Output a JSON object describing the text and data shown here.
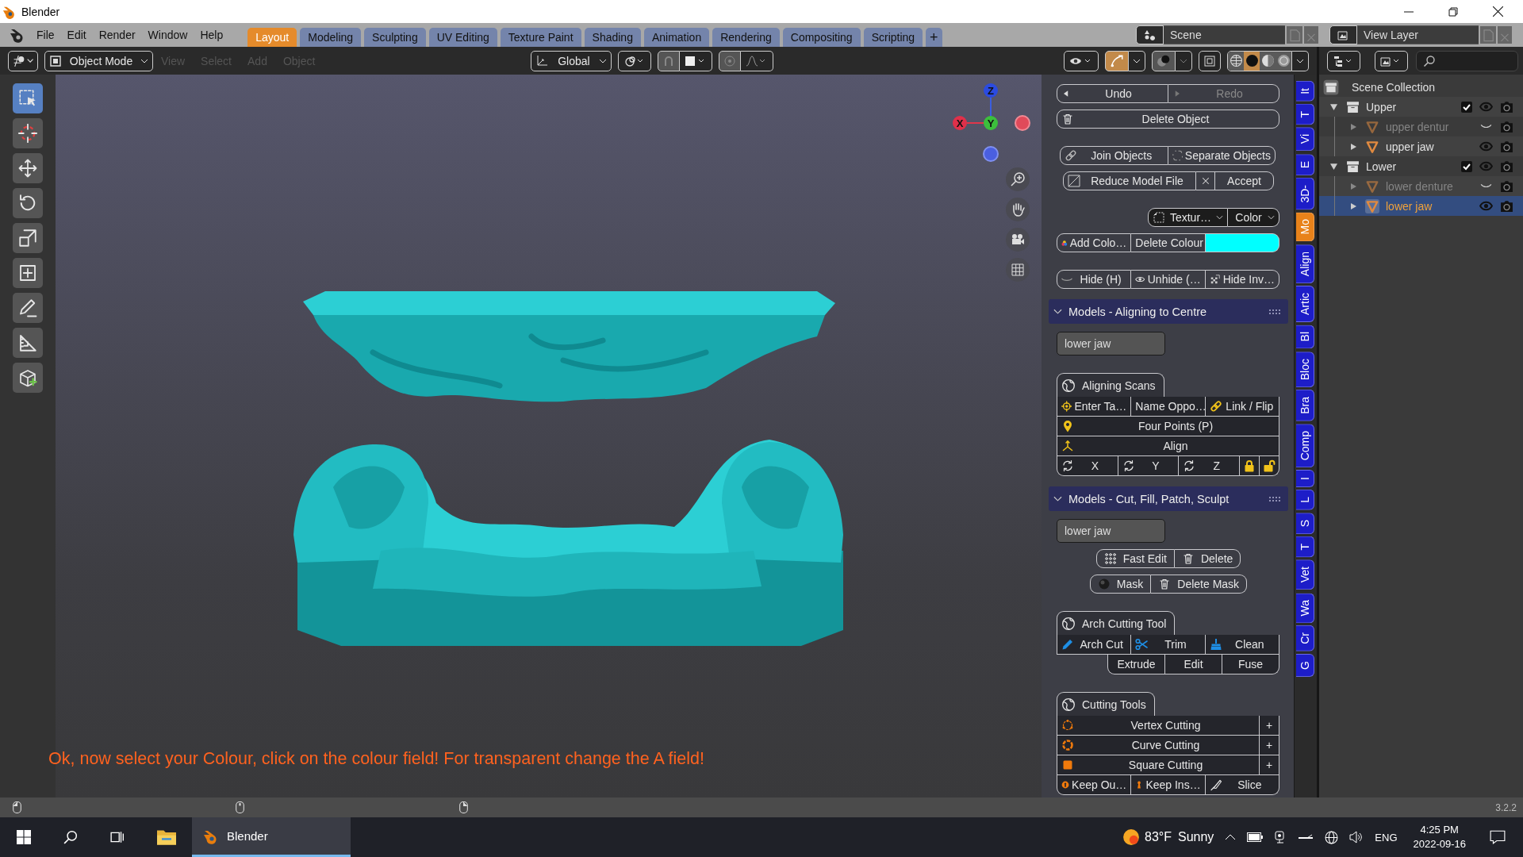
{
  "window": {
    "title": "Blender"
  },
  "topbar": {
    "menus": [
      "File",
      "Edit",
      "Render",
      "Window",
      "Help"
    ],
    "workspaces": [
      {
        "label": "Layout",
        "selected": true
      },
      {
        "label": "Modeling",
        "selected": false
      },
      {
        "label": "Sculpting",
        "selected": false
      },
      {
        "label": "UV Editing",
        "selected": false
      },
      {
        "label": "Texture Paint",
        "selected": false
      },
      {
        "label": "Shading",
        "selected": false
      },
      {
        "label": "Animation",
        "selected": false
      },
      {
        "label": "Rendering",
        "selected": false
      },
      {
        "label": "Compositing",
        "selected": false
      },
      {
        "label": "Scripting",
        "selected": false
      }
    ],
    "add_tab": "+",
    "scene": "Scene",
    "view_layer": "View Layer"
  },
  "header": {
    "mode": "Object Mode",
    "menus": [
      {
        "label": "View",
        "disabled": true
      },
      {
        "label": "Select",
        "disabled": true
      },
      {
        "label": "Add",
        "disabled": true
      },
      {
        "label": "Object",
        "disabled": true
      }
    ],
    "orientation": "Global",
    "gizmos_on": true,
    "shading": [
      {
        "kind": "wireframe",
        "selected": false
      },
      {
        "kind": "solid",
        "selected": true
      },
      {
        "kind": "material",
        "selected": false
      },
      {
        "kind": "rendered",
        "selected": false
      }
    ]
  },
  "tools": [
    {
      "kind": "select",
      "selected": true
    },
    {
      "kind": "cursor",
      "selected": false
    },
    {
      "kind": "move",
      "selected": false
    },
    {
      "kind": "t_rotate",
      "selected": false
    },
    {
      "kind": "scale",
      "selected": false
    },
    {
      "kind": "transform",
      "selected": false
    },
    {
      "kind": "annotate",
      "selected": false
    },
    {
      "kind": "measure",
      "selected": false
    },
    {
      "kind": "add_cube",
      "selected": false
    }
  ],
  "gizmo": {
    "z": "Z",
    "x": "X",
    "y": "Y"
  },
  "message": "Ok, now select your Colour, click on the colour field! For transparent change the A field!",
  "panel": {
    "undo": {
      "label": "Undo",
      "disabled": false
    },
    "redo": {
      "label": "Redo",
      "disabled": true
    },
    "delete_object": "Delete Object",
    "join": "Join Objects",
    "separate": "Separate Objects",
    "reduce": "Reduce Model File",
    "accept": "Accept",
    "texture": "Textur…",
    "color_mode": "Color",
    "add_colour": "Add Colo…",
    "delete_colour": "Delete Colour",
    "colour_field": {
      "color": "#00ffff"
    },
    "hide": "Hide (H)",
    "unhide": "Unhide (…",
    "hide_invert": "Hide Inv…"
  },
  "sections": [
    {
      "title": "Models - Aligning to Centre",
      "expanded": true,
      "object": "lower jaw",
      "groups": [
        {
          "title": "Aligning Scans",
          "rows": [
            {
              "kind": "full",
              "buttons": [
                {
                  "label": "Enter Ta…",
                  "kind": "target"
                },
                {
                  "label": "Name Oppo…",
                  "kind": "none"
                },
                {
                  "label": "Link / Flip",
                  "kind": "link"
                }
              ]
            },
            {
              "kind": "full",
              "buttons": [
                {
                  "label": "Four Points (P)",
                  "kind": "pin"
                }
              ]
            },
            {
              "kind": "full",
              "buttons": [
                {
                  "label": "Align",
                  "kind": "axes"
                }
              ]
            },
            {
              "kind": "full",
              "buttons": [
                {
                  "label": "X",
                  "kind": "rotate"
                },
                {
                  "label": "Y",
                  "kind": "rotate"
                },
                {
                  "label": "Z",
                  "kind": "rotate"
                },
                {
                  "kind": "lock",
                  "locked": true
                },
                {
                  "kind": "lock",
                  "locked": false
                }
              ]
            }
          ]
        }
      ]
    },
    {
      "title": "Models - Cut, Fill, Patch, Sculpt",
      "expanded": true,
      "object": "lower jaw",
      "buttons": [
        {
          "kind": "center",
          "buttons": [
            {
              "label": "Fast Edit",
              "kind": "dots"
            },
            {
              "label": "Delete",
              "kind": "trash"
            }
          ]
        },
        {
          "kind": "center",
          "buttons": [
            {
              "label": "Mask",
              "kind": "sphere"
            },
            {
              "label": "Delete Mask",
              "kind": "trash"
            }
          ]
        }
      ],
      "groups": [
        {
          "title": "Arch Cutting Tool",
          "rows": [
            {
              "kind": "full",
              "buttons": [
                {
                  "label": "Arch Cut",
                  "kind": "pencil"
                },
                {
                  "label": "Trim",
                  "kind": "scissors"
                },
                {
                  "label": "Clean",
                  "kind": "brush"
                }
              ]
            },
            {
              "kind": "inset",
              "buttons": [
                {
                  "label": "Extrude",
                  "kind": "none"
                },
                {
                  "label": "Edit",
                  "kind": "none"
                },
                {
                  "label": "Fuse",
                  "kind": "none"
                }
              ]
            }
          ]
        },
        {
          "title": "Cutting Tools",
          "rows": [
            {
              "kind": "full",
              "buttons": [
                {
                  "label": "Vertex Cutting",
                  "kind": "vertex"
                },
                {
                  "label": "+",
                  "kind": "plus"
                }
              ]
            },
            {
              "kind": "full",
              "buttons": [
                {
                  "label": "Curve Cutting",
                  "kind": "curve"
                },
                {
                  "label": "+",
                  "kind": "plus"
                }
              ]
            },
            {
              "kind": "full",
              "buttons": [
                {
                  "label": "Square Cutting",
                  "kind": "square"
                },
                {
                  "label": "+",
                  "kind": "plus"
                }
              ]
            },
            {
              "kind": "full",
              "buttons": [
                {
                  "label": "Keep Ou…",
                  "kind": "keyout"
                },
                {
                  "label": "Keep Ins…",
                  "kind": "keyin"
                },
                {
                  "label": "Slice",
                  "kind": "knife"
                }
              ]
            }
          ]
        }
      ]
    }
  ],
  "sidebar_tabs": [
    {
      "label": "It",
      "selected": false
    },
    {
      "label": "T",
      "selected": false
    },
    {
      "label": "Vi",
      "selected": false
    },
    {
      "label": "E",
      "selected": false
    },
    {
      "label": "3D-",
      "selected": false
    },
    {
      "label": "Mo",
      "selected": true
    },
    {
      "label": "Align",
      "selected": false
    },
    {
      "label": "Artic",
      "selected": false
    },
    {
      "label": "Bl",
      "selected": false
    },
    {
      "label": "Bloc",
      "selected": false
    },
    {
      "label": "Bra",
      "selected": false
    },
    {
      "label": "Comp",
      "selected": false
    },
    {
      "label": "I",
      "selected": false
    },
    {
      "label": "L",
      "selected": false
    },
    {
      "label": "S",
      "selected": false
    },
    {
      "label": "T",
      "selected": false
    },
    {
      "label": "Vet",
      "selected": false
    },
    {
      "label": "Wa",
      "selected": false
    },
    {
      "label": "Cr",
      "selected": false
    },
    {
      "label": "G",
      "selected": false
    }
  ],
  "outliner": {
    "root": "Scene Collection",
    "items": [
      {
        "name": "Upper",
        "kind": "collection",
        "expanded": true,
        "included": true,
        "hidden": false,
        "selected": false,
        "children": [
          {
            "name": "upper dentur",
            "kind": "mesh",
            "expanded": false,
            "hidden": true,
            "selected": false
          },
          {
            "name": "upper jaw",
            "kind": "mesh",
            "expanded": false,
            "hidden": false,
            "selected": false
          }
        ]
      },
      {
        "name": "Lower",
        "kind": "collection",
        "expanded": true,
        "included": true,
        "hidden": false,
        "selected": false,
        "children": [
          {
            "name": "lower denture",
            "kind": "mesh",
            "expanded": false,
            "hidden": true,
            "selected": false
          },
          {
            "name": "lower jaw",
            "kind": "mesh",
            "expanded": false,
            "hidden": false,
            "selected": true
          }
        ]
      }
    ]
  },
  "statusbar": {
    "version": "3.2.2"
  },
  "taskbar": {
    "app": {
      "label": "Blender",
      "selected": true
    },
    "temperature": "83°F",
    "weather": "Sunny",
    "language": "ENG",
    "time": "4:25 PM",
    "date": "2022-09-16"
  }
}
